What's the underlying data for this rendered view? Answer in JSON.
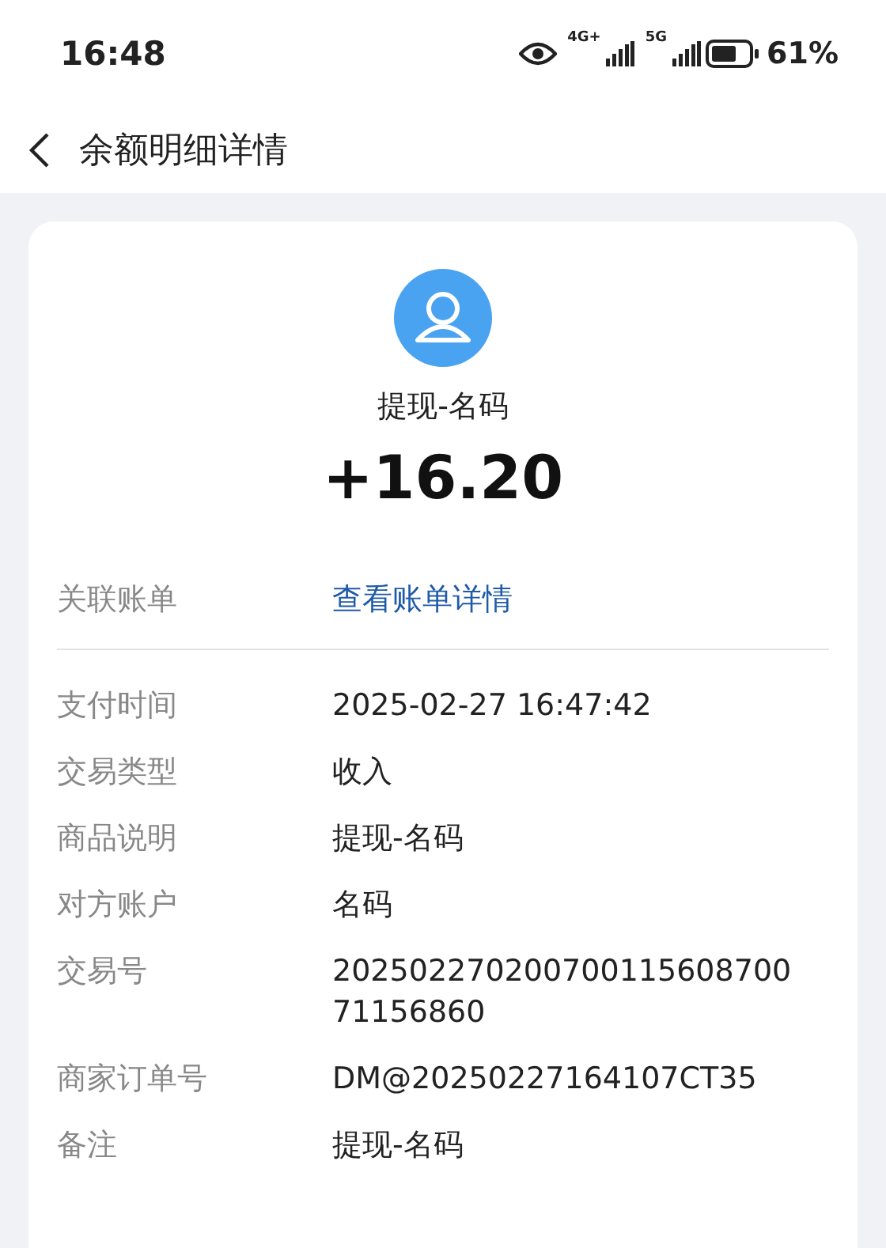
{
  "status_bar": {
    "time": "16:48",
    "network_1": "4G+",
    "network_2": "5G",
    "battery_level": "61%"
  },
  "header": {
    "title": "余额明细详情"
  },
  "summary": {
    "title": "提现-名码",
    "amount": "+16.20"
  },
  "linked": {
    "label": "关联账单",
    "value": "查看账单详情",
    "kind": "link"
  },
  "details": [
    {
      "label": "支付时间",
      "value": "2025-02-27 16:47:42"
    },
    {
      "label": "交易类型",
      "value": "收入"
    },
    {
      "label": "商品说明",
      "value": "提现-名码"
    },
    {
      "label": "对方账户",
      "value": "名码"
    },
    {
      "label": "交易号",
      "value": "20250227020070011560870071156860"
    },
    {
      "label": "商家订单号",
      "value": "DM@20250227164107CT35"
    },
    {
      "label": "备注",
      "value": "提现-名码"
    }
  ]
}
